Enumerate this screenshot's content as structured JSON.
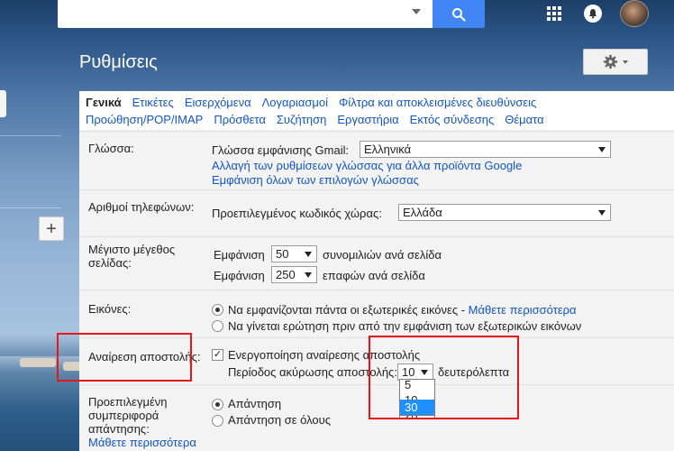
{
  "topbar": {
    "search": {
      "value": "",
      "placeholder": ""
    },
    "icons": [
      "search-icon",
      "apps-icon",
      "notifications-icon",
      "account-avatar"
    ]
  },
  "page": {
    "title": "Ρυθμίσεις"
  },
  "tabs": {
    "row1": [
      "Γενικά",
      "Ετικέτες",
      "Εισερχόμενα",
      "Λογαριασμοί",
      "Φίλτρα και αποκλεισμένες διευθύνσεις"
    ],
    "row2": [
      "Προώθηση/POP/IMAP",
      "Πρόσθετα",
      "Συζήτηση",
      "Εργαστήρια",
      "Εκτός σύνδεσης",
      "Θέματα"
    ],
    "active": "Γενικά"
  },
  "settings": {
    "language": {
      "label": "Γλώσσα:",
      "display_label": "Γλώσσα εμφάνισης Gmail:",
      "display_value": "Ελληνικά",
      "link1": "Αλλαγή των ρυθμίσεων γλώσσας για άλλα προϊόντα Google",
      "link2": "Εμφάνιση όλων των επιλογών γλώσσας"
    },
    "phone": {
      "label": "Αριθμοί τηλεφώνων:",
      "country_label": "Προεπιλεγμένος κωδικός χώρας:",
      "country_value": "Ελλάδα"
    },
    "page_size": {
      "label": "Μέγιστο μέγεθος σελίδας:",
      "show": "Εμφάνιση",
      "conversations_value": "50",
      "conversations_suffix": "συνομιλιών ανά σελίδα",
      "contacts_value": "250",
      "contacts_suffix": "επαφών ανά σελίδα"
    },
    "images": {
      "label": "Εικόνες:",
      "option1": "Να εμφανίζονται πάντα οι εξωτερικές εικόνες",
      "option1_sep": " - ",
      "learn_more": "Μάθετε περισσότερα",
      "option2": "Να γίνεται ερώτηση πριν από την εμφάνιση των εξωτερικών εικόνων",
      "selected": 1
    },
    "undo_send": {
      "label": "Αναίρεση αποστολής:",
      "enable_label": "Ενεργοποίηση αναίρεσης αποστολής",
      "enabled": true,
      "period_label": "Περίοδος ακύρωσης αποστολής:",
      "period_value": "10",
      "period_suffix": "δευτερόλεπτα",
      "options": [
        "5",
        "10",
        "20",
        "30"
      ],
      "highlighted_option": "30"
    },
    "reply": {
      "label": "Προεπιλεγμένη συμπεριφορά απάντησης:",
      "learn_more": "Μάθετε περισσότερα",
      "option1": "Απάντηση",
      "option2": "Απάντηση σε όλους",
      "selected": 1
    }
  },
  "colors": {
    "link": "#1155cc",
    "search_button": "#4285f4",
    "annotation": "#e8161b",
    "dropdown_highlight": "#1e90ff"
  }
}
